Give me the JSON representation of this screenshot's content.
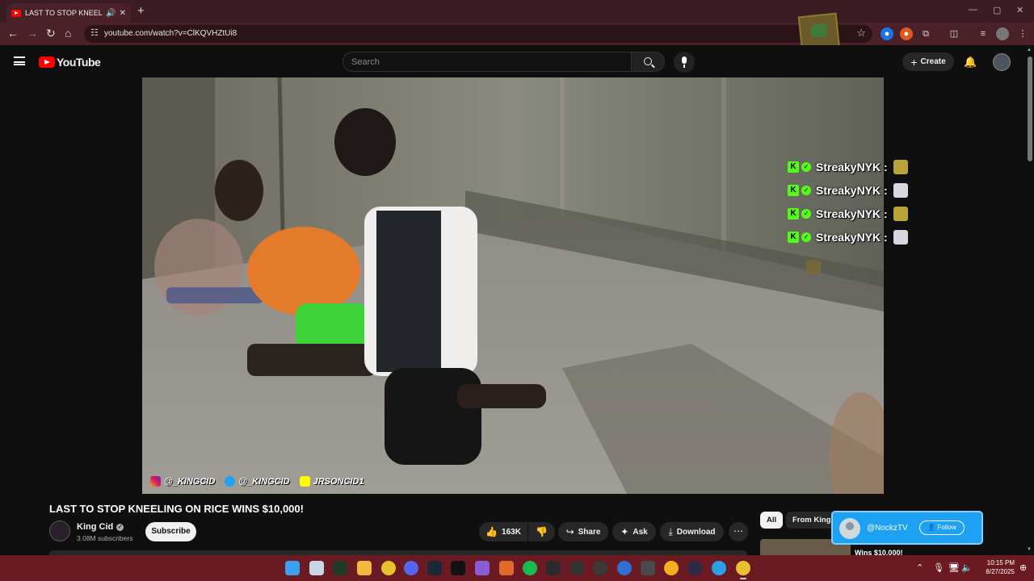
{
  "browser": {
    "tab_title": "LAST TO STOP KNEELING O",
    "tab_audio_icon": "speaker-icon",
    "tab_close": "✕",
    "new_tab": "+",
    "url": "youtube.com/watch?v=ClKQVHZtUi8",
    "window_controls": [
      "—",
      "▢",
      "✕"
    ]
  },
  "youtube": {
    "logo_text": "YouTube",
    "search_placeholder": "Search",
    "create_label": "Create"
  },
  "video": {
    "chat": [
      {
        "user": "StreakyNYK :",
        "emote": "cheering-emote"
      },
      {
        "user": "StreakyNYK :",
        "emote": "goat-emote"
      },
      {
        "user": "StreakyNYK :",
        "emote": "cheering-emote"
      },
      {
        "user": "StreakyNYK :",
        "emote": "goat-emote"
      }
    ],
    "socials": [
      {
        "platform": "instagram",
        "handle": "@_KINGCID"
      },
      {
        "platform": "twitter",
        "handle": "@_KINGCID"
      },
      {
        "platform": "snapchat",
        "handle": "JRSONCID1"
      }
    ]
  },
  "watch": {
    "title": "LAST TO STOP KNEELING ON RICE WINS $10,000!",
    "channel_name": "King Cid",
    "subscribers": "3.08M subscribers",
    "subscribe_label": "Subscribe",
    "likes": "163K",
    "share_label": "Share",
    "ask_label": "Ask",
    "download_label": "Download",
    "more_label": "⋯"
  },
  "sidebar": {
    "chips": [
      "All",
      "From King"
    ],
    "recommendation_title": "Wins $10,000!"
  },
  "follow_card": {
    "name": "@NockzTV",
    "button": "Follow"
  },
  "taskbar": {
    "time": "10:15 PM",
    "date": "8/27/2025"
  },
  "colors": {
    "youtube_red": "#ff0000",
    "kick_green": "#53fc18",
    "twitter_blue": "#1da1f2",
    "browser_frame": "#4b2129",
    "taskbar": "#6b1a22"
  }
}
